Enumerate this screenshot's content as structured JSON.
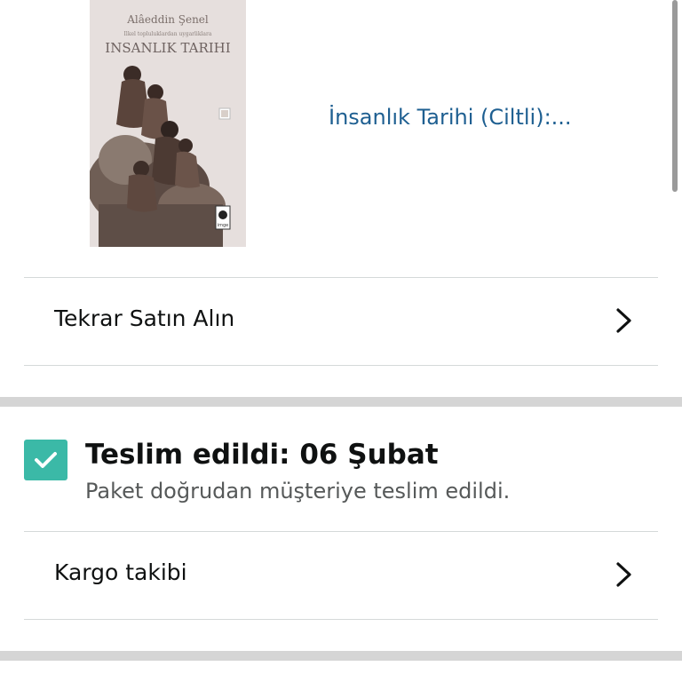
{
  "product": {
    "link_text": "İnsanlık Tarihi (Ciltli):...",
    "cover": {
      "author": "Alâeddin Şenel",
      "subtitle": "Ilkel topluluklardan uygarliklara",
      "title": "INSANLIK TARIHI",
      "publisher": "imge"
    }
  },
  "actions": {
    "buy_again_label": "Tekrar Satın Alın",
    "track_package_label": "Kargo takibi"
  },
  "delivery": {
    "status_title": "Teslim edildi: 06 Şubat",
    "status_detail": "Paket doğrudan müşteriye teslim edildi."
  },
  "colors": {
    "link": "#1e5f91",
    "check_badge": "#3bb9a7",
    "divider": "#d5d9d9",
    "section_gap": "#d5d5d5"
  }
}
